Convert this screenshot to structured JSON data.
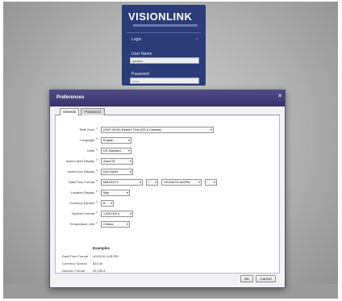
{
  "login": {
    "logo": "VISIONLINK",
    "heading": "Login",
    "arrow": "›",
    "user_label": "User Name",
    "user_value": "rpentz1",
    "pass_label": "Password",
    "pass_value": "••••••"
  },
  "dialog": {
    "title": "Preferences",
    "close_glyph": "✕",
    "tabs": [
      "General",
      "Password"
    ],
    "fields": {
      "timezone": {
        "label": "Time Zone",
        "value": "(GMT-05:00) Eastern Time (US & Canada)"
      },
      "language": {
        "label": "Language",
        "value": "English"
      },
      "units": {
        "label": "Units",
        "value": "US Standard"
      },
      "asset_label": {
        "label": "Asset Label Display",
        "value": "Asset ID"
      },
      "asset_icon": {
        "label": "Asset Icon Display",
        "value": "Icon Name"
      },
      "datetime": {
        "label": "Date/Time Format",
        "date_value": "MM/DD/YY",
        "sep_value": "/",
        "time_value": "HH:MM:SS AM/PM",
        "extra_value": ":"
      },
      "location": {
        "label": "Location Display",
        "value": "Map"
      },
      "currency": {
        "label": "Currency Symbol",
        "value": "$"
      },
      "number": {
        "label": "Number Format",
        "value": "1,000,000.0"
      },
      "temperature": {
        "label": "Temperature Unit",
        "value": "Celsius"
      }
    },
    "dropdown_glyph": "▾",
    "required_glyph": "*",
    "examples": {
      "title": "Examples",
      "items": [
        {
          "label": "Date/Time Format",
          "value": "10/10/16 4:48 PM"
        },
        {
          "label": "Currency Symbol",
          "value": "$15.00"
        },
        {
          "label": "Number Format",
          "value": "26,155.8"
        }
      ]
    },
    "ok_label": "OK",
    "cancel_label": "Cancel"
  }
}
